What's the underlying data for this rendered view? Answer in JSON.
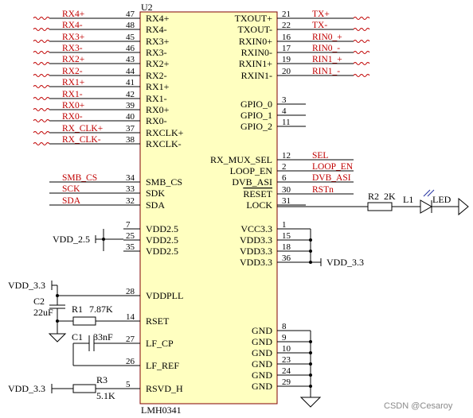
{
  "chip": {
    "ref": "U2",
    "part": "LMH0341",
    "left_pins": [
      {
        "num": "47",
        "name": "RX4+",
        "net": "RX4+"
      },
      {
        "num": "48",
        "name": "RX4-",
        "net": "RX4-"
      },
      {
        "num": "45",
        "name": "RX3+",
        "net": "RX3+"
      },
      {
        "num": "46",
        "name": "RX3-",
        "net": "RX3-"
      },
      {
        "num": "43",
        "name": "RX2+",
        "net": "RX2+"
      },
      {
        "num": "44",
        "name": "RX2-",
        "net": "RX2-"
      },
      {
        "num": "41",
        "name": "RX1+",
        "net": "RX1+"
      },
      {
        "num": "42",
        "name": "RX1-",
        "net": "RX1-"
      },
      {
        "num": "39",
        "name": "RX0+",
        "net": "RX0+"
      },
      {
        "num": "40",
        "name": "RX0-",
        "net": "RX0-"
      },
      {
        "num": "37",
        "name": "RXCLK+",
        "net": "RX_CLK+"
      },
      {
        "num": "38",
        "name": "RXCLK-",
        "net": "RX_CLK-"
      },
      {
        "num": "34",
        "name": "SMB_CS",
        "net": "SMB_CS"
      },
      {
        "num": "33",
        "name": "SDK",
        "net": "SCK"
      },
      {
        "num": "32",
        "name": "SDA",
        "net": "SDA"
      },
      {
        "num": "7",
        "name": "VDD2.5",
        "net": ""
      },
      {
        "num": "25",
        "name": "VDD2.5",
        "net": ""
      },
      {
        "num": "35",
        "name": "VDD2.5",
        "net": ""
      },
      {
        "num": "28",
        "name": "VDDPLL",
        "net": ""
      },
      {
        "num": "14",
        "name": "RSET",
        "net": ""
      },
      {
        "num": "27",
        "name": "LF_CP",
        "net": ""
      },
      {
        "num": "26",
        "name": "LF_REF",
        "net": ""
      },
      {
        "num": "5",
        "name": "RSVD_H",
        "net": ""
      }
    ],
    "right_pins": [
      {
        "num": "21",
        "name": "TXOUT+",
        "net": "TX+"
      },
      {
        "num": "22",
        "name": "TXOUT-",
        "net": "TX-"
      },
      {
        "num": "16",
        "name": "RXIN0+",
        "net": "RIN0_+"
      },
      {
        "num": "17",
        "name": "RXIN0-",
        "net": "RIN0_-"
      },
      {
        "num": "19",
        "name": "RXIN1+",
        "net": "RIN1_+"
      },
      {
        "num": "20",
        "name": "RXIN1-",
        "net": "RIN1_-"
      },
      {
        "num": "3",
        "name": "GPIO_0",
        "net": ""
      },
      {
        "num": "4",
        "name": "GPIO_1",
        "net": ""
      },
      {
        "num": "11",
        "name": "GPIO_2",
        "net": ""
      },
      {
        "num": "12",
        "name": "RX_MUX_SEL",
        "net": "SEL"
      },
      {
        "num": "2",
        "name": "LOOP_EN",
        "net": "LOOP_EN"
      },
      {
        "num": "6",
        "name": "DVB_ASI",
        "net": "DVB_ASI"
      },
      {
        "num": "30",
        "name": "RESET",
        "net": "RSTn"
      },
      {
        "num": "31",
        "name": "LOCK",
        "net": ""
      },
      {
        "num": "1",
        "name": "VCC3.3",
        "net": ""
      },
      {
        "num": "15",
        "name": "VDD3.3",
        "net": ""
      },
      {
        "num": "18",
        "name": "VDD3.3",
        "net": ""
      },
      {
        "num": "36",
        "name": "VDD3.3",
        "net": ""
      },
      {
        "num": "8",
        "name": "GND",
        "net": ""
      },
      {
        "num": "9",
        "name": "GND",
        "net": ""
      },
      {
        "num": "10",
        "name": "GND",
        "net": ""
      },
      {
        "num": "23",
        "name": "GND",
        "net": ""
      },
      {
        "num": "24",
        "name": "GND",
        "net": ""
      },
      {
        "num": "29",
        "name": "GND",
        "net": ""
      }
    ]
  },
  "power": {
    "vdd25": "VDD_2.5",
    "vdd33_right": "VDD_3.3",
    "vdd33_pll": "VDD_3.3",
    "vdd33_rsvd": "VDD_3.3"
  },
  "parts": {
    "r2_ref": "R2",
    "r2_val": "2K",
    "l1_ref": "L1",
    "led_label": "LED",
    "c2_ref": "C2",
    "c2_val": "22uF",
    "r1_ref": "R1",
    "r1_val": "7.87K",
    "c1_ref": "C1",
    "c1_val": "33nF",
    "r3_ref": "R3",
    "r3_val": "5.1K"
  },
  "watermark": "CSDN @Cesaroy"
}
